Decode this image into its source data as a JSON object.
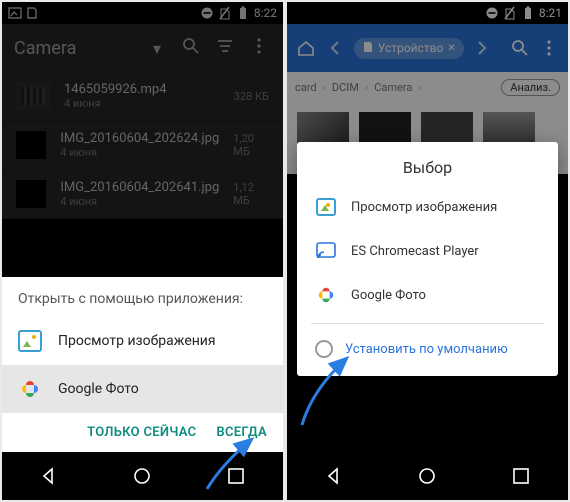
{
  "left": {
    "status": {
      "time": "8:22"
    },
    "toolbar": {
      "title": "Camera"
    },
    "files": [
      {
        "name": "1465059926.mp4",
        "date": "4 июня",
        "size": "328 КБ",
        "type": "video"
      },
      {
        "name": "IMG_20160604_202624.jpg",
        "date": "4 июня",
        "size": "1,20 МБ",
        "type": "image"
      },
      {
        "name": "IMG_20160604_202641.jpg",
        "date": "4 июня",
        "size": "1,12 МБ",
        "type": "image"
      }
    ],
    "sheet": {
      "title": "Открыть с помощью приложения:",
      "options": [
        {
          "label": "Просмотр изображения"
        },
        {
          "label": "Google Фото"
        }
      ],
      "just_once": "ТОЛЬКО СЕЙЧАС",
      "always": "ВСЕГДА"
    }
  },
  "right": {
    "status": {
      "time": "8:21"
    },
    "device": {
      "label": "Устройство"
    },
    "breadcrumb": {
      "root": "card",
      "mid": "DCIM",
      "leaf": "Camera",
      "analyze": "Анализ."
    },
    "dialog": {
      "title": "Выбор",
      "options": [
        {
          "label": "Просмотр изображения"
        },
        {
          "label": "ES Chromecast Player"
        },
        {
          "label": "Google Фото"
        }
      ],
      "set_default": "Установить по умолчанию"
    }
  }
}
